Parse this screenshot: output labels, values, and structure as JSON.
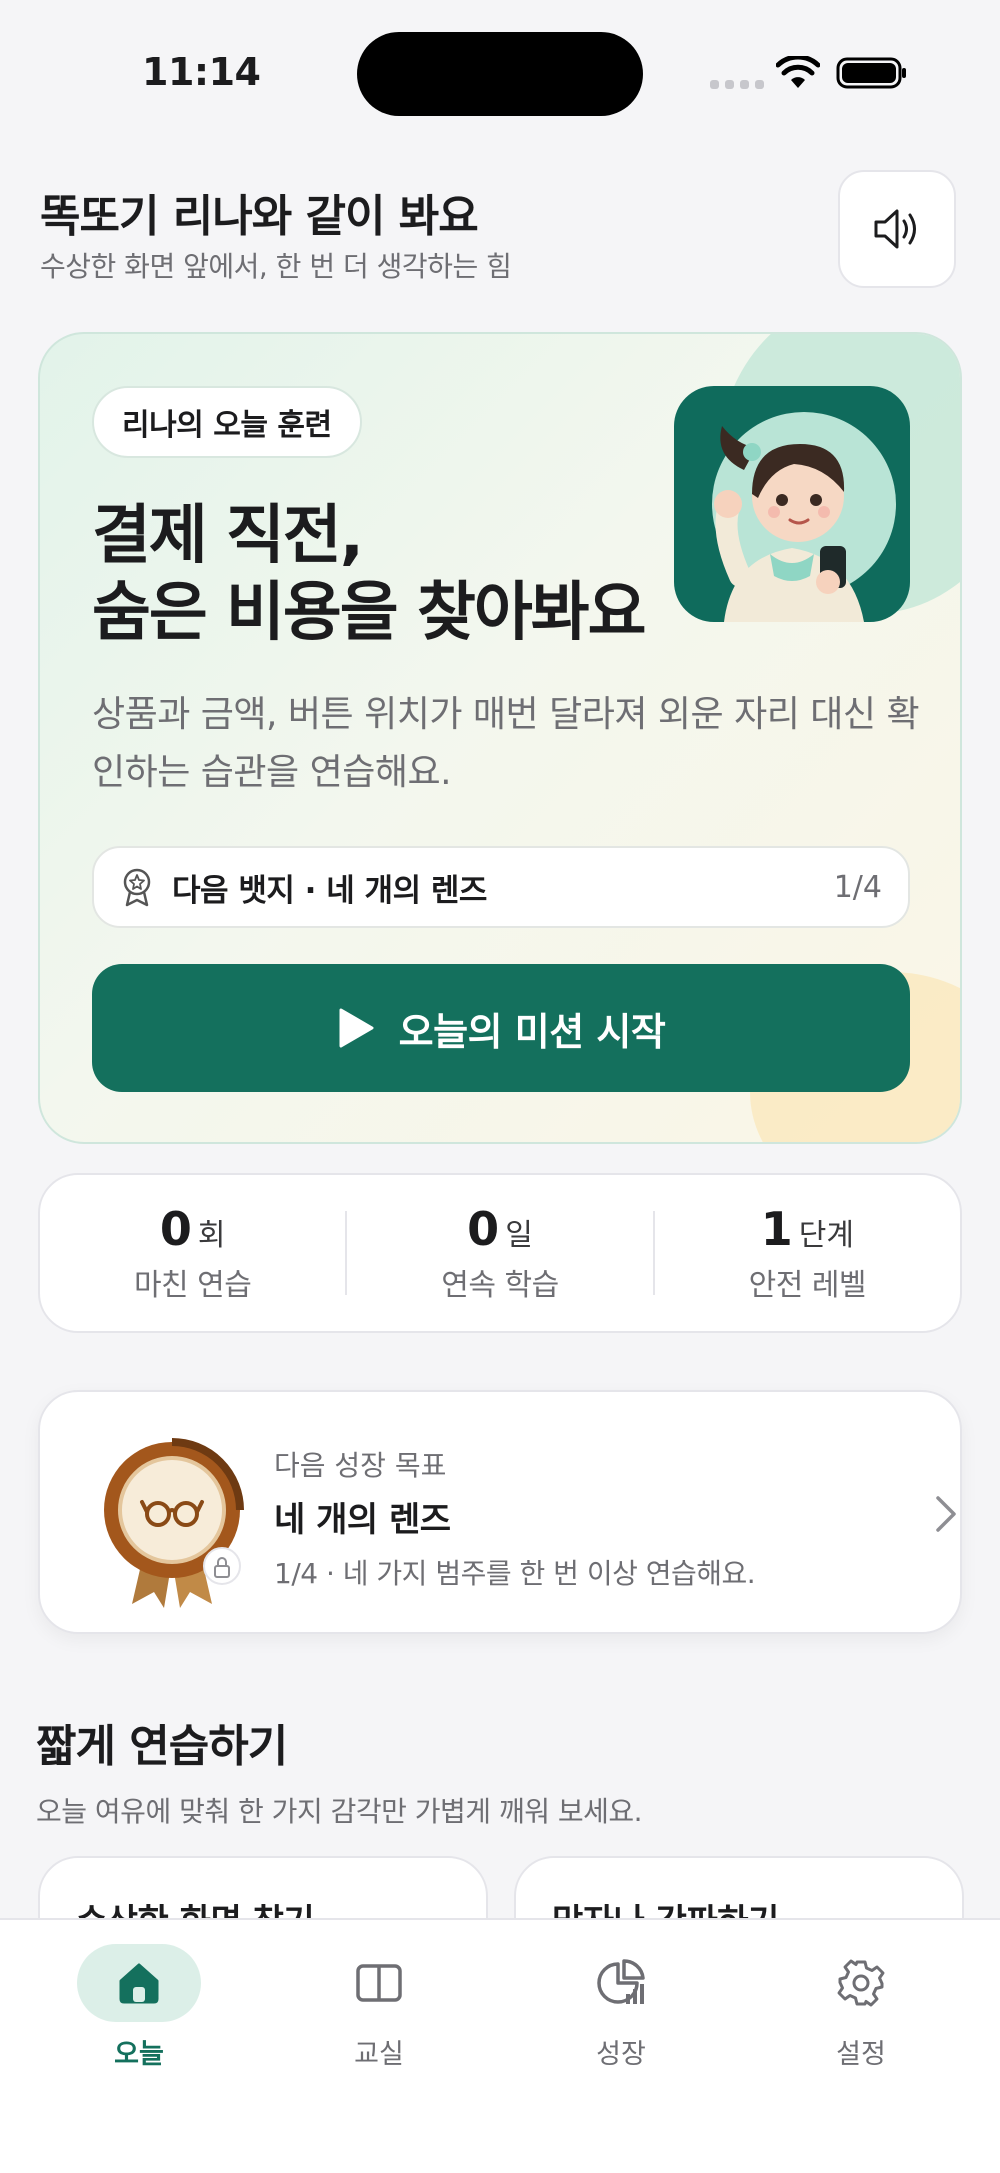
{
  "status_bar": {
    "time": "11:14"
  },
  "header": {
    "title": "똑또기 리나와 같이 봐요",
    "subtitle": "수상한 화면 앞에서, 한 번 더 생각하는 힘"
  },
  "hero": {
    "tag": "리나의 오늘 훈련",
    "title_line1": "결제 직전,",
    "title_line2": "숨은 비용을 찾아봐요",
    "description": "상품과 금액, 버튼 위치가 매번 달라져 외운 자리 대신 확인하는 습관을 연습해요.",
    "badge_label": "다음 뱃지 · 네 개의 렌즈",
    "badge_progress": "1/4",
    "cta_label": "오늘의 미션 시작"
  },
  "stats": [
    {
      "value": "0",
      "unit": "회",
      "label": "마친 연습"
    },
    {
      "value": "0",
      "unit": "일",
      "label": "연속 학습"
    },
    {
      "value": "1",
      "unit": "단계",
      "label": "안전 레벨"
    }
  ],
  "goal": {
    "kicker": "다음 성장 목표",
    "title": "네 개의 렌즈",
    "description": "1/4 · 네 가지 범주를 한 번 이상 연습해요."
  },
  "practice": {
    "title": "짧게 연습하기",
    "subtitle": "오늘 여유에 맞춰 한 가지 감각만 가볍게 깨워 보세요.",
    "cards": [
      {
        "title": "수상한 화면 찾기"
      },
      {
        "title": "망자나 간파하기"
      }
    ]
  },
  "tabs": [
    {
      "label": "오늘",
      "icon": "home-icon",
      "active": true
    },
    {
      "label": "교실",
      "icon": "book-icon",
      "active": false
    },
    {
      "label": "성장",
      "icon": "growth-chart-icon",
      "active": false
    },
    {
      "label": "설정",
      "icon": "gear-icon",
      "active": false
    }
  ],
  "colors": {
    "accent": "#14705d",
    "background": "#f5f5f7",
    "hero_gradient_start": "#e2f3ea",
    "hero_gradient_end": "#fbf6e6"
  }
}
